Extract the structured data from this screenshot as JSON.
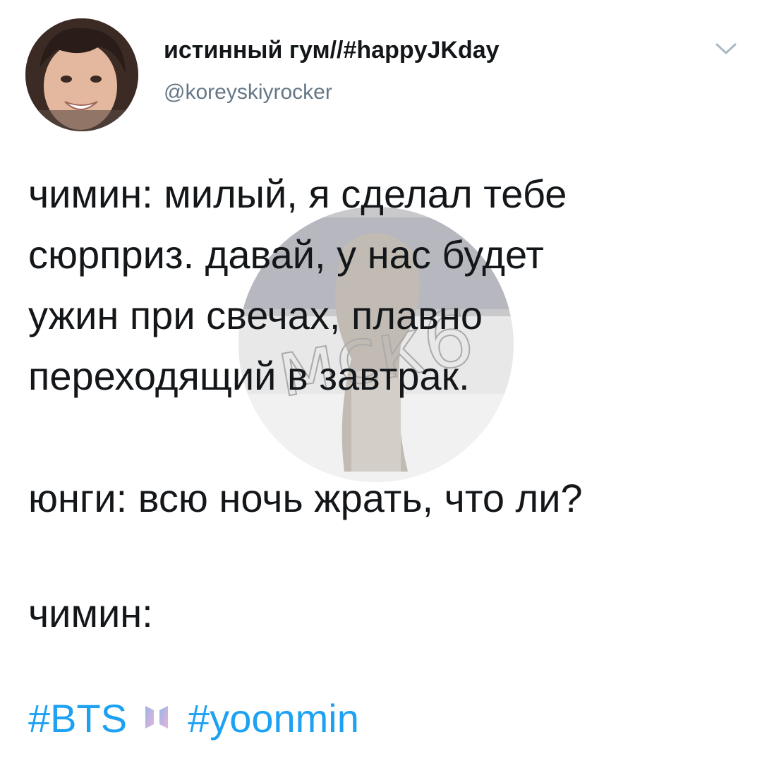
{
  "tweet": {
    "author": {
      "display_name": "истинный гум//#happyJKday",
      "handle": "@koreyskiyrocker",
      "avatar_icon": "user-avatar-photo"
    },
    "menu_icon": "chevron-down-icon",
    "body_lines": [
      "чимин: милый, я сделал тебе",
      "сюрприз. давай, у нас будет",
      "ужин при свечах, плавно",
      "переходящий в завтрак.",
      "юнги: всю ночь жрать, что ли?",
      "чимин:"
    ],
    "hashtags": [
      {
        "text": "#BTS",
        "emoji": "bts-logo-icon"
      },
      {
        "text": "#yoonmin"
      }
    ],
    "watermark_text": "мск6"
  },
  "colors": {
    "text": "#14171a",
    "secondary": "#657786",
    "link": "#1da1f2",
    "caret": "#aab8c2"
  }
}
